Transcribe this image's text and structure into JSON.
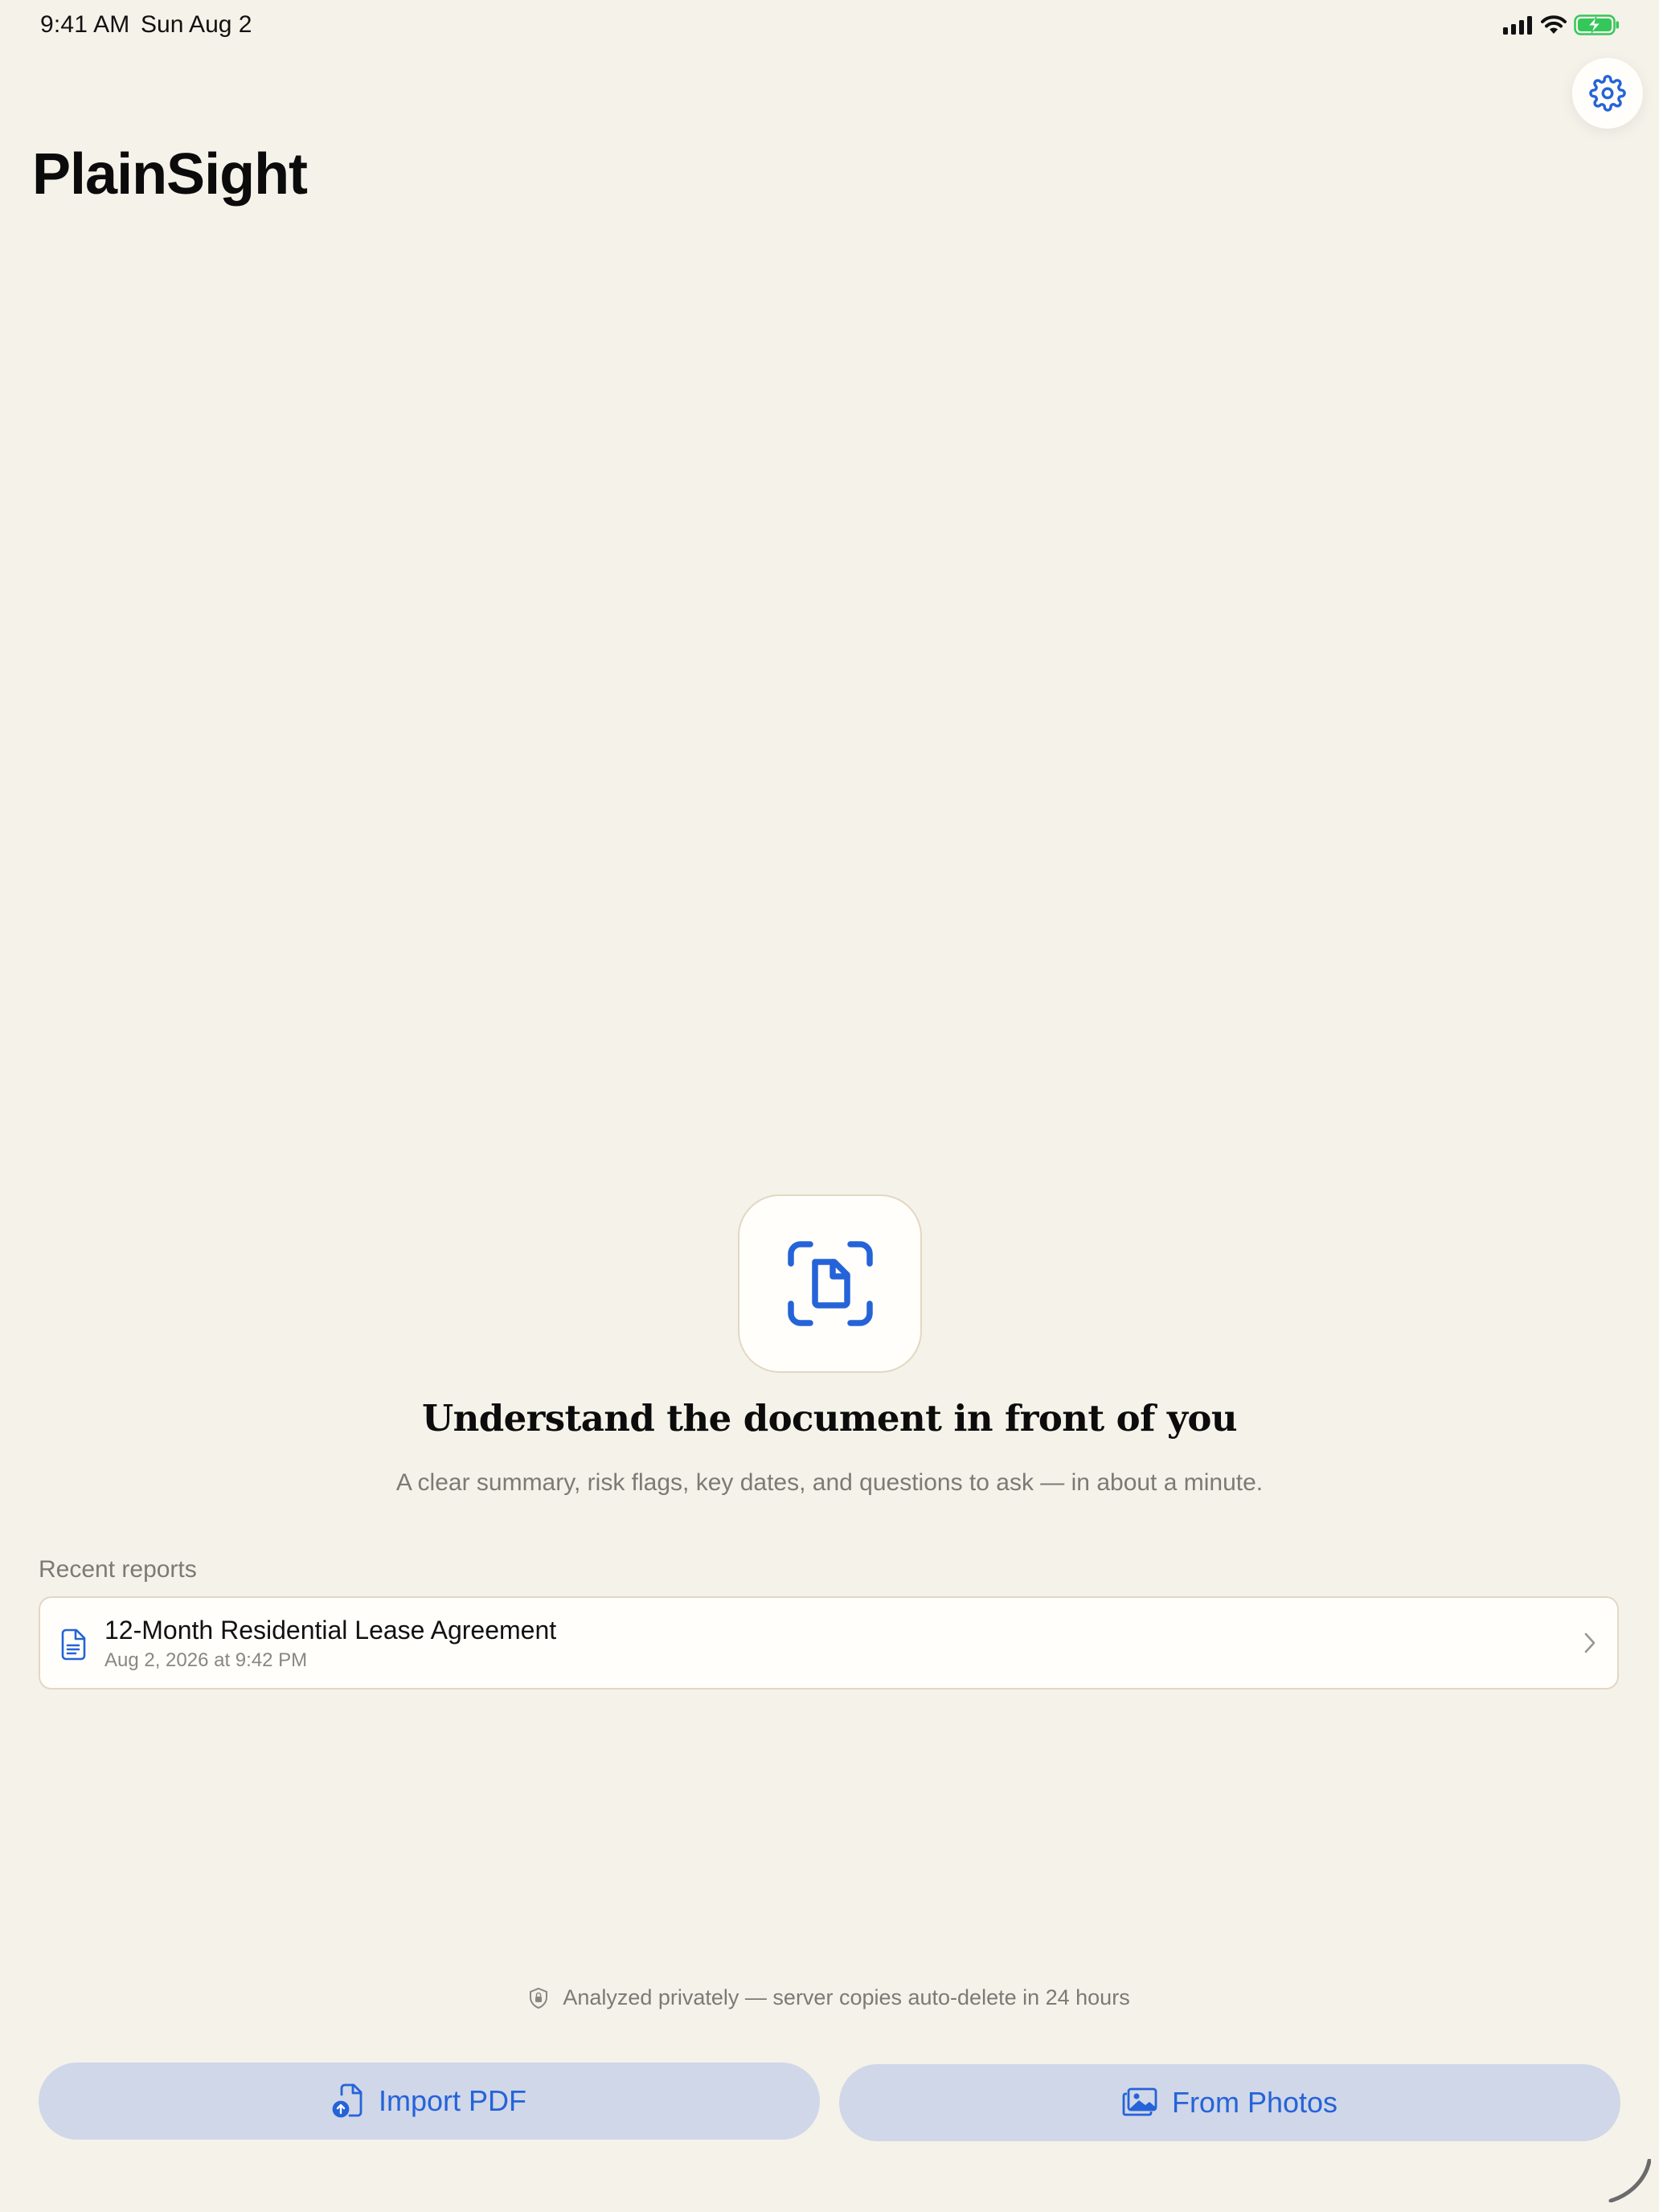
{
  "status_bar": {
    "time": "9:41 AM",
    "date": "Sun Aug 2",
    "icons": [
      "cellular-signal-icon",
      "wifi-icon",
      "battery-charging-icon"
    ]
  },
  "header": {
    "app_title": "PlainSight",
    "settings_icon": "gear-icon"
  },
  "hero": {
    "icon": "document-scan-icon",
    "title": "Understand the document in front of you",
    "subtitle": "A clear summary, risk flags, key dates, and questions to ask — in about a minute."
  },
  "recent": {
    "header": "Recent reports",
    "items": [
      {
        "title": "12-Month Residential Lease Agreement",
        "meta": "Aug 2, 2026 at 9:42 PM",
        "icon": "document-text-icon"
      }
    ]
  },
  "footer": {
    "privacy_note": "Analyzed privately — server copies auto-delete in 24 hours",
    "privacy_icon": "shield-lock-icon",
    "import_label": "Import PDF",
    "import_icon": "document-upload-icon",
    "photos_label": "From Photos",
    "photos_icon": "photos-icon"
  },
  "colors": {
    "background": "#f5f2ea",
    "accent": "#2563d8",
    "button_fill": "#d0d7e8",
    "card_border": "#e3d7c3",
    "secondary_text": "#7d7a75",
    "battery_green": "#34c759"
  }
}
